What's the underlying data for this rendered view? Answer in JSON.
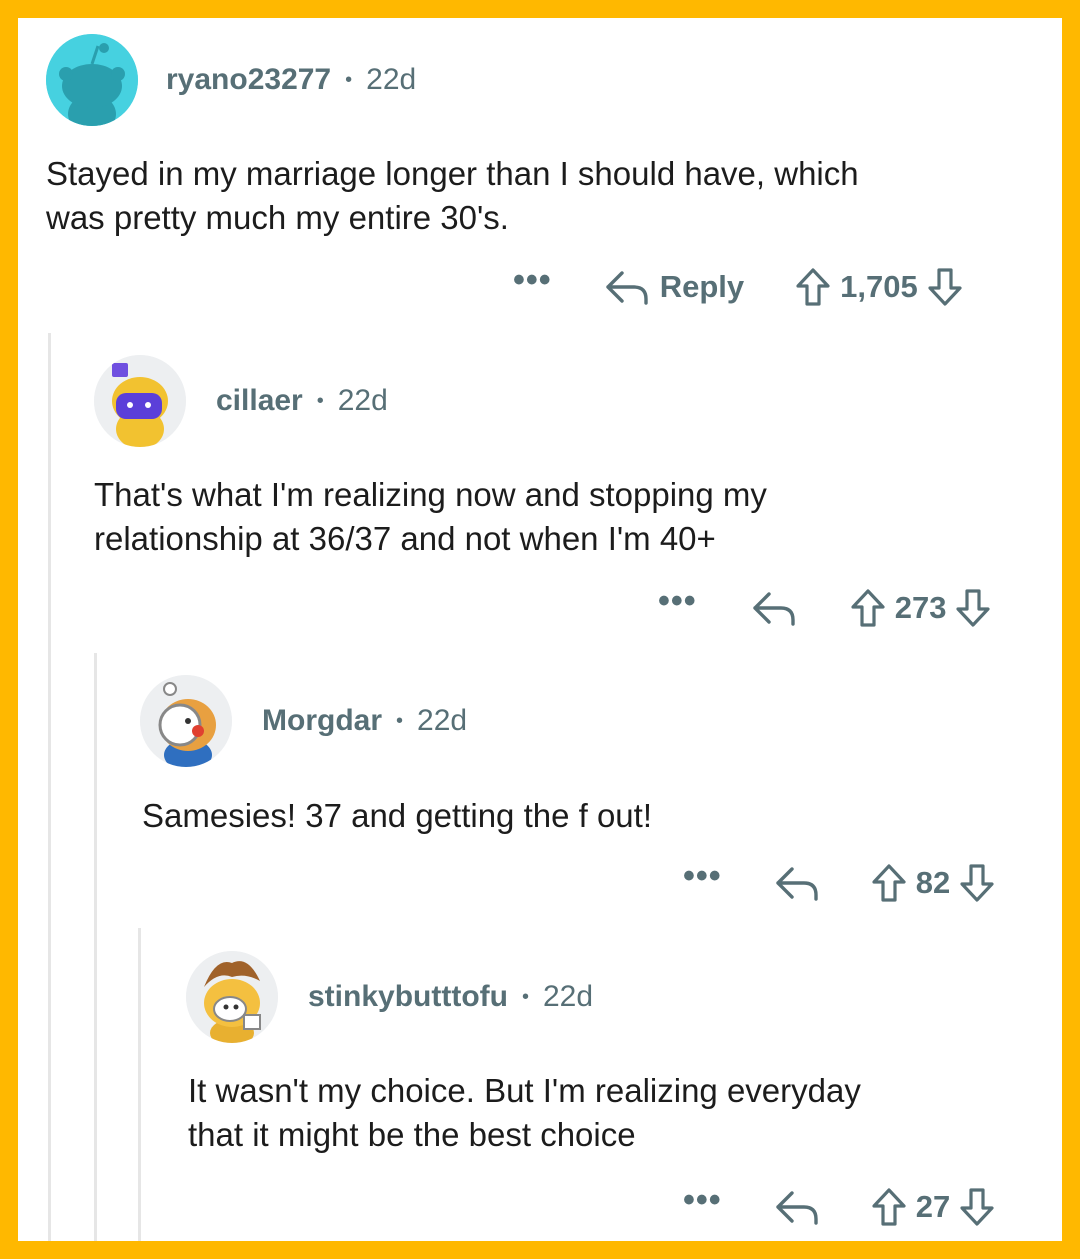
{
  "comments": [
    {
      "username": "ryano23277",
      "separator": "•",
      "age": "22d",
      "text": "Stayed in my marriage longer than I should have, which\nwas pretty much my entire 30's.",
      "more": "•••",
      "reply_label": "Reply",
      "score": "1,705",
      "avatar_color": "#46D1E0"
    },
    {
      "username": "cillaer",
      "separator": "•",
      "age": "22d",
      "text": "That's what I'm realizing now and stopping my\nrelationship at 36/37 and not when I'm 40+",
      "more": "•••",
      "score": "273",
      "avatar_color": "#F2C230"
    },
    {
      "username": "Morgdar",
      "separator": "•",
      "age": "22d",
      "text": "Samesies! 37 and getting the f out!",
      "more": "•••",
      "score": "82",
      "avatar_color": "#E8A040"
    },
    {
      "username": "stinkybutttofu",
      "separator": "•",
      "age": "22d",
      "text": "It wasn't my choice. But I'm realizing everyday\nthat it might be the best choice",
      "more": "•••",
      "score": "27",
      "avatar_color": "#F4C040"
    }
  ],
  "colors": {
    "frame": "#FFB800",
    "meta_text": "#576F76",
    "body_text": "#1C1C1C",
    "thread_line": "#E6E6E6"
  },
  "icons": [
    "reply-arrow-icon",
    "upvote-arrow-icon",
    "downvote-arrow-icon",
    "overflow-menu-icon"
  ]
}
